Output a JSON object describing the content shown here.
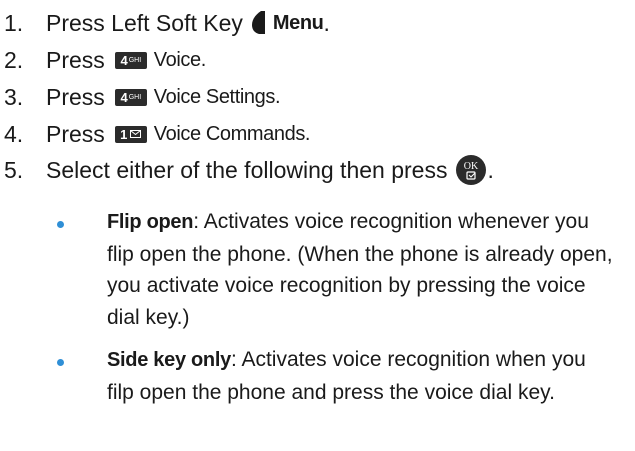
{
  "steps": [
    {
      "num": "1.",
      "lead": "Press Left Soft Key",
      "key_icon": "left-soft-key-icon",
      "label": "Menu",
      "tail": "."
    },
    {
      "num": "2.",
      "lead": "Press",
      "key_icon": "key-4-ghi-icon",
      "key_digit": "4",
      "key_letters": "GHI",
      "label": "Voice."
    },
    {
      "num": "3.",
      "lead": "Press",
      "key_icon": "key-4-ghi-icon",
      "key_digit": "4",
      "key_letters": "GHI",
      "label": "Voice Settings."
    },
    {
      "num": "4.",
      "lead": "Press",
      "key_icon": "key-1-mail-icon",
      "key_digit": "1",
      "label": "Voice Commands."
    },
    {
      "num": "5.",
      "lead": "Select either of the following then press",
      "key_icon": "ok-key-icon",
      "tail": "."
    }
  ],
  "options": [
    {
      "term": "Flip open",
      "description": ": Activates voice recognition whenever you flip open the phone. (When the phone is already open, you activate voice recognition by pressing the voice dial key.)"
    },
    {
      "term": "Side key only",
      "description": ": Activates voice recognition when you filp open the phone and press the voice dial key."
    }
  ],
  "colors": {
    "text": "#1a1a1a",
    "bullet": "#2f8fd6",
    "key_badge": "#2b2b2b"
  }
}
